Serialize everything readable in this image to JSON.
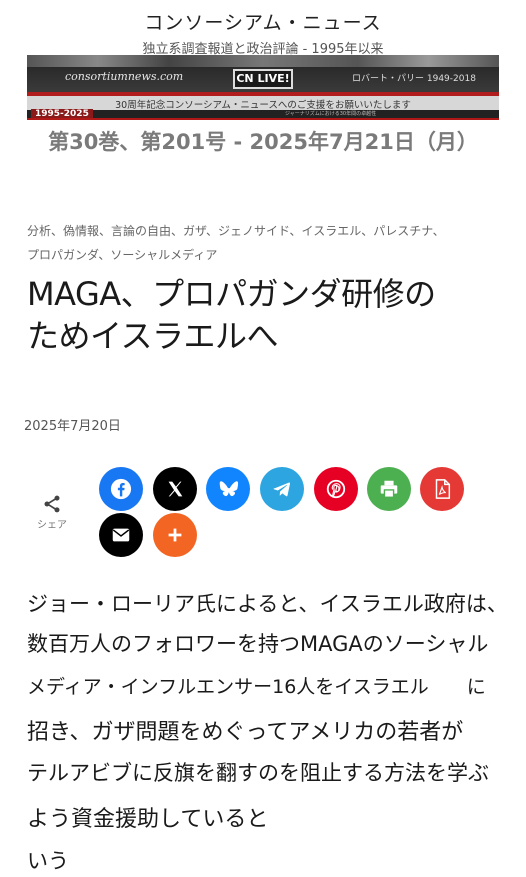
{
  "site": {
    "title": "コンソーシアム・ニュース",
    "tagline": "独立系調査報道と政治評論 - 1995年以来"
  },
  "banner": {
    "domain": "consortiumnews.com",
    "logo_text": "CN LIVE!",
    "founder": "ロバート・パリー 1949-2018",
    "appeal": "30周年記念コンソーシアム・ニュースへのご支援をお願いいたします",
    "years": "1995-2025",
    "small_text": "ジャーナリズムにおける30年間の卓越性",
    "colors": {
      "accent_red": "#b11c1c"
    }
  },
  "issue": "第30巻、第201号 - 2025年7月21日（月）",
  "article": {
    "categories_line1": "分析、偽情報、言論の自由、ガザ、ジェノサイド、イスラエル、パレスチナ、",
    "categories_line2": "プロパガンダ、ソーシャルメディア",
    "title_line1": "MAGA、プロパガンダ研修の",
    "title_line2": "ためイスラエルへ",
    "date": "2025年7月20日",
    "body": [
      "ジョー・ローリア氏によると、イスラエル政府は、",
      "数百万人のフォロワーを持つMAGAのソーシャル",
      "メディア・インフルエンサー16人をイスラエル　　に",
      "招き、ガザ問題をめぐってアメリカの若者が",
      "テルアビブに反旗を翻すのを阻止する方法を学ぶ",
      "よう資金援助していると",
      "いう"
    ]
  },
  "share": {
    "label": "シェア",
    "icon": "share-icon",
    "buttons": [
      {
        "name": "facebook",
        "icon": "facebook-icon",
        "color": "#1877f2"
      },
      {
        "name": "x",
        "icon": "x-icon",
        "color": "#000000"
      },
      {
        "name": "bluesky",
        "icon": "bluesky-icon",
        "color": "#1185fe"
      },
      {
        "name": "telegram",
        "icon": "telegram-icon",
        "color": "#2ca5e0"
      },
      {
        "name": "pinterest",
        "icon": "pinterest-icon",
        "color": "#e60023"
      },
      {
        "name": "print",
        "icon": "print-icon",
        "color": "#4caf50"
      },
      {
        "name": "pdf",
        "icon": "pdf-icon",
        "color": "#e53935"
      },
      {
        "name": "email",
        "icon": "email-icon",
        "color": "#000000"
      },
      {
        "name": "more",
        "icon": "plus-icon",
        "color": "#f26522"
      }
    ]
  }
}
